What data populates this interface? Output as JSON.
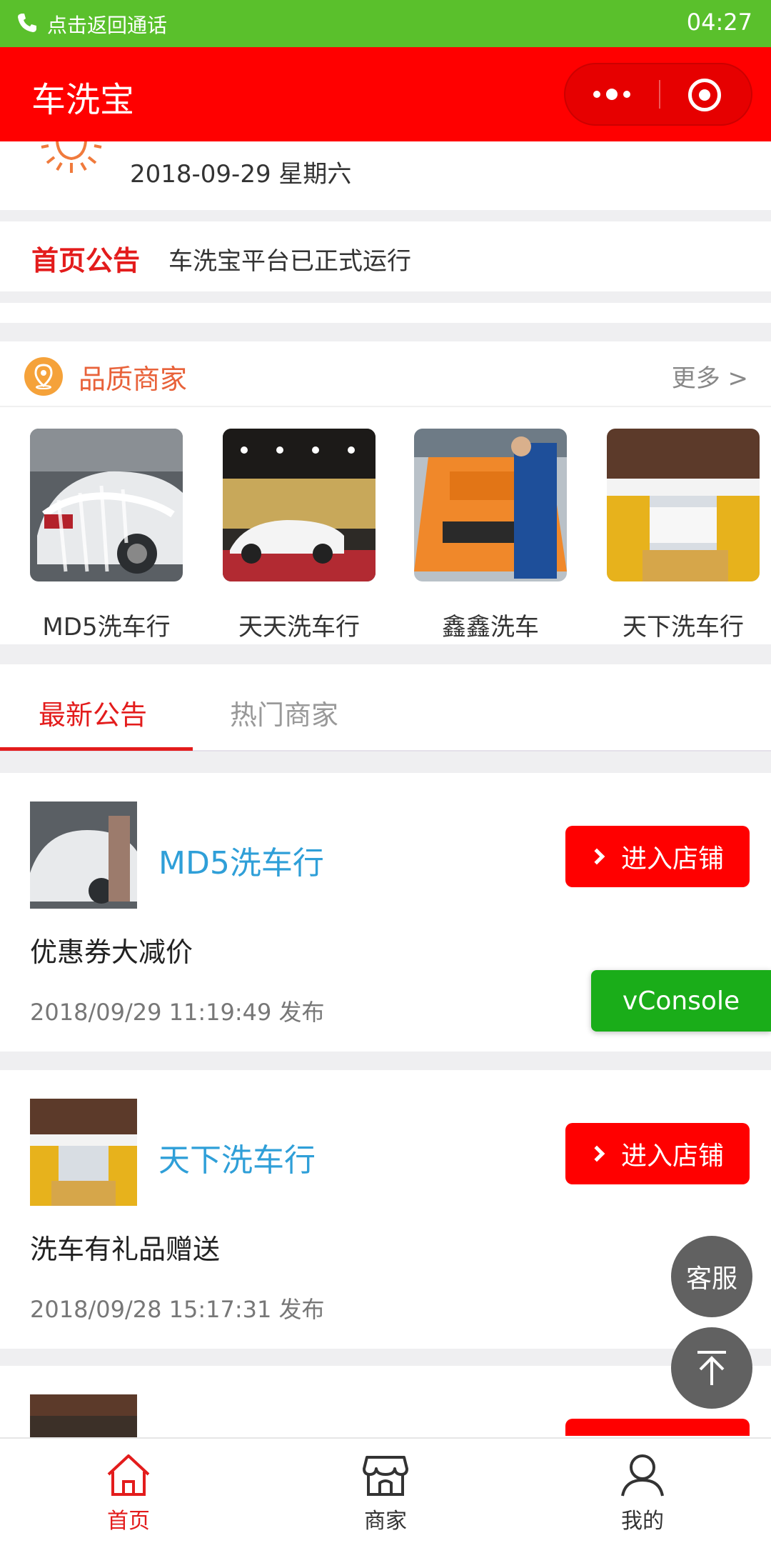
{
  "status_bar": {
    "call_text": "点击返回通话",
    "time": "04:27"
  },
  "nav": {
    "title": "车洗宝"
  },
  "date_strip": {
    "date": "2018-09-29 星期六"
  },
  "notice": {
    "label": "首页公告",
    "text": "车洗宝平台已正式运行"
  },
  "quality": {
    "title": "品质商家",
    "more": "更多 >",
    "merchants": [
      {
        "name": "MD5洗车行"
      },
      {
        "name": "天天洗车行"
      },
      {
        "name": "鑫鑫洗车"
      },
      {
        "name": "天下洗车行"
      }
    ]
  },
  "tabs": {
    "active": "最新公告",
    "inactive": "热门商家"
  },
  "announcements": [
    {
      "store": "MD5洗车行",
      "button": "进入店铺",
      "desc": "优惠券大减价",
      "time": "2018/09/29 11:19:49 发布"
    },
    {
      "store": "天下洗车行",
      "button": "进入店铺",
      "desc": "洗车有礼品赠送",
      "time": "2018/09/28 15:17:31 发布"
    }
  ],
  "floating": {
    "vconsole": "vConsole",
    "service": "客服"
  },
  "tabbar": {
    "home": "首页",
    "shop": "商家",
    "mine": "我的"
  },
  "colors": {
    "status_green": "#5ac02c",
    "nav_red": "#ff0000",
    "accent_red": "#e31c1c",
    "link_blue": "#2f9fd8",
    "vconsole_green": "#1aad19"
  }
}
